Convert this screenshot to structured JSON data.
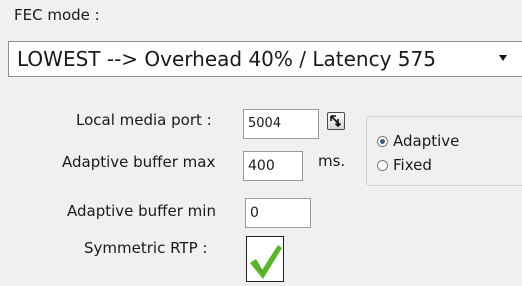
{
  "fec": {
    "label": "FEC mode :",
    "selected": "LOWEST --> Overhead 40% / Latency 575"
  },
  "local_media_port": {
    "label": "Local media port :",
    "value": "5004"
  },
  "adaptive_buffer_max": {
    "label": "Adaptive buffer max",
    "value": "400",
    "unit": "ms."
  },
  "adaptive_buffer_min": {
    "label": "Adaptive buffer min",
    "value": "0"
  },
  "symmetric_rtp": {
    "label": "Symmetric RTP :",
    "checked": true
  },
  "buffer_mode": {
    "options": [
      {
        "label": "Adaptive",
        "selected": true
      },
      {
        "label": "Fixed",
        "selected": false
      }
    ]
  },
  "icons": {
    "spin": "spin-updown-icon",
    "dropdown": "chevron-down-icon",
    "check": "green-checkmark-icon"
  },
  "colors": {
    "check": "#5ab52c",
    "radio_dot": "#3a5a8a"
  }
}
